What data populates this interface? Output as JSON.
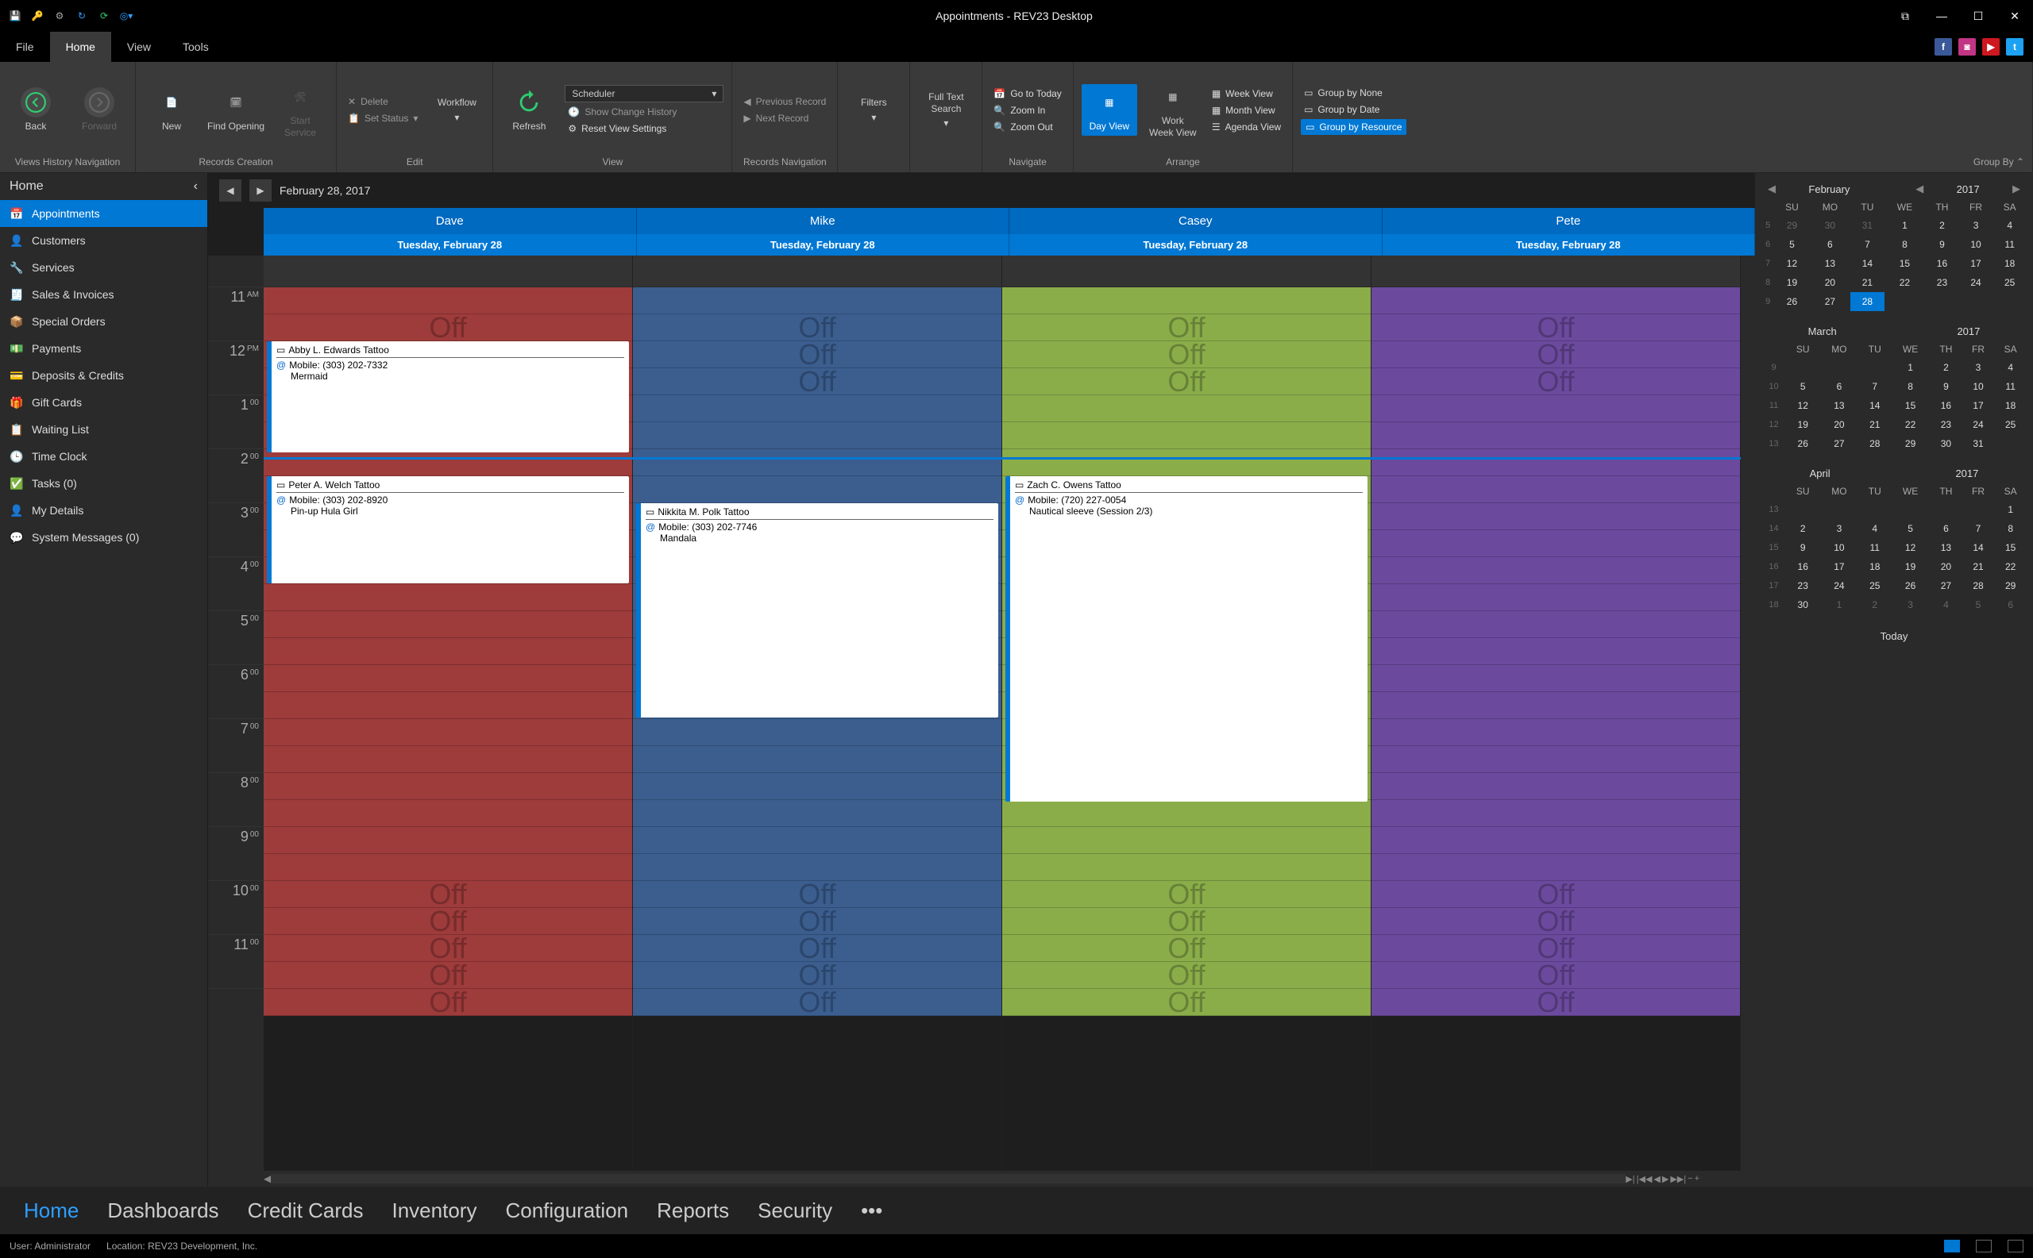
{
  "window": {
    "title": "Appointments - REV23 Desktop"
  },
  "menutabs": {
    "file": "File",
    "home": "Home",
    "view": "View",
    "tools": "Tools"
  },
  "ribbon": {
    "groups": {
      "nav": {
        "label": "Views History Navigation",
        "back": "Back",
        "forward": "Forward"
      },
      "records": {
        "label": "Records Creation",
        "new": "New",
        "find": "Find Opening",
        "start": "Start\nService"
      },
      "edit": {
        "label": "Edit",
        "delete": "Delete",
        "status": "Set Status",
        "workflow": "Workflow"
      },
      "view": {
        "label": "View",
        "refresh": "Refresh",
        "scheduler": "Scheduler",
        "history": "Show Change History",
        "reset": "Reset View Settings"
      },
      "recnav": {
        "label": "Records Navigation",
        "prev": "Previous Record",
        "next": "Next Record"
      },
      "filters": "Filters",
      "fulltext": "Full Text\nSearch",
      "navigate": {
        "label": "Navigate",
        "today": "Go to Today",
        "zoomin": "Zoom In",
        "zoomout": "Zoom Out"
      },
      "arrange": {
        "label": "Arrange",
        "dayview": "Day View",
        "workweek": "Work\nWeek View",
        "week": "Week View",
        "month": "Month View",
        "agenda": "Agenda View"
      },
      "groupby": {
        "label": "Group By",
        "none": "Group by None",
        "date": "Group by Date",
        "resource": "Group by Resource"
      }
    }
  },
  "leftnav": {
    "header": "Home",
    "items": [
      "Appointments",
      "Customers",
      "Services",
      "Sales & Invoices",
      "Special Orders",
      "Payments",
      "Deposits & Credits",
      "Gift Cards",
      "Waiting List",
      "Time Clock",
      "Tasks (0)",
      "My Details",
      "System Messages (0)"
    ]
  },
  "datebar": {
    "date": "February 28, 2017"
  },
  "resources": [
    "Dave",
    "Mike",
    "Casey",
    "Pete"
  ],
  "dayheader": "Tuesday, February 28",
  "times": [
    "11 AM",
    "12 PM",
    "1 00",
    "2 00",
    "3 00",
    "4 00",
    "5 00",
    "6 00",
    "7 00",
    "8 00",
    "9 00",
    "10 00",
    "11 00"
  ],
  "off": "Off",
  "appointments": {
    "dave1": {
      "title": "Abby L. Edwards Tattoo",
      "phone": "Mobile: (303) 202-7332",
      "desc": "Mermaid"
    },
    "dave2": {
      "title": "Peter A. Welch Tattoo",
      "phone": "Mobile: (303) 202-8920",
      "desc": "Pin-up Hula Girl"
    },
    "mike1": {
      "title": "Nikkita M. Polk Tattoo",
      "phone": "Mobile: (303) 202-7746",
      "desc": "Mandala"
    },
    "casey1": {
      "title": "Zach C. Owens Tattoo",
      "phone": "Mobile: (720) 227-0054",
      "desc": "Nautical sleeve (Session 2/3)"
    }
  },
  "minicalendars": {
    "dow": [
      "SU",
      "MO",
      "TU",
      "WE",
      "TH",
      "FR",
      "SA"
    ],
    "feb": {
      "month": "February",
      "year": "2017",
      "weeks": [
        {
          "wk": "5",
          "days": [
            {
              "d": "29",
              "dim": true
            },
            {
              "d": "30",
              "dim": true
            },
            {
              "d": "31",
              "dim": true
            },
            {
              "d": "1"
            },
            {
              "d": "2"
            },
            {
              "d": "3"
            },
            {
              "d": "4"
            }
          ]
        },
        {
          "wk": "6",
          "days": [
            {
              "d": "5"
            },
            {
              "d": "6"
            },
            {
              "d": "7"
            },
            {
              "d": "8"
            },
            {
              "d": "9"
            },
            {
              "d": "10"
            },
            {
              "d": "11"
            }
          ]
        },
        {
          "wk": "7",
          "days": [
            {
              "d": "12"
            },
            {
              "d": "13"
            },
            {
              "d": "14"
            },
            {
              "d": "15"
            },
            {
              "d": "16"
            },
            {
              "d": "17"
            },
            {
              "d": "18"
            }
          ]
        },
        {
          "wk": "8",
          "days": [
            {
              "d": "19"
            },
            {
              "d": "20"
            },
            {
              "d": "21"
            },
            {
              "d": "22"
            },
            {
              "d": "23"
            },
            {
              "d": "24"
            },
            {
              "d": "25"
            }
          ]
        },
        {
          "wk": "9",
          "days": [
            {
              "d": "26"
            },
            {
              "d": "27"
            },
            {
              "d": "28",
              "sel": true
            },
            {
              "d": ""
            },
            {
              "d": ""
            },
            {
              "d": ""
            },
            {
              "d": ""
            }
          ]
        }
      ]
    },
    "mar": {
      "month": "March",
      "year": "2017",
      "weeks": [
        {
          "wk": "9",
          "days": [
            {
              "d": ""
            },
            {
              "d": ""
            },
            {
              "d": ""
            },
            {
              "d": "1"
            },
            {
              "d": "2"
            },
            {
              "d": "3"
            },
            {
              "d": "4"
            }
          ]
        },
        {
          "wk": "10",
          "days": [
            {
              "d": "5"
            },
            {
              "d": "6"
            },
            {
              "d": "7"
            },
            {
              "d": "8"
            },
            {
              "d": "9"
            },
            {
              "d": "10"
            },
            {
              "d": "11"
            }
          ]
        },
        {
          "wk": "11",
          "days": [
            {
              "d": "12"
            },
            {
              "d": "13"
            },
            {
              "d": "14"
            },
            {
              "d": "15"
            },
            {
              "d": "16"
            },
            {
              "d": "17"
            },
            {
              "d": "18"
            }
          ]
        },
        {
          "wk": "12",
          "days": [
            {
              "d": "19"
            },
            {
              "d": "20"
            },
            {
              "d": "21"
            },
            {
              "d": "22"
            },
            {
              "d": "23"
            },
            {
              "d": "24"
            },
            {
              "d": "25"
            }
          ]
        },
        {
          "wk": "13",
          "days": [
            {
              "d": "26"
            },
            {
              "d": "27"
            },
            {
              "d": "28"
            },
            {
              "d": "29"
            },
            {
              "d": "30"
            },
            {
              "d": "31"
            },
            {
              "d": ""
            }
          ]
        }
      ]
    },
    "apr": {
      "month": "April",
      "year": "2017",
      "weeks": [
        {
          "wk": "13",
          "days": [
            {
              "d": ""
            },
            {
              "d": ""
            },
            {
              "d": ""
            },
            {
              "d": ""
            },
            {
              "d": ""
            },
            {
              "d": ""
            },
            {
              "d": "1"
            }
          ]
        },
        {
          "wk": "14",
          "days": [
            {
              "d": "2"
            },
            {
              "d": "3"
            },
            {
              "d": "4"
            },
            {
              "d": "5"
            },
            {
              "d": "6"
            },
            {
              "d": "7"
            },
            {
              "d": "8"
            }
          ]
        },
        {
          "wk": "15",
          "days": [
            {
              "d": "9"
            },
            {
              "d": "10"
            },
            {
              "d": "11"
            },
            {
              "d": "12"
            },
            {
              "d": "13"
            },
            {
              "d": "14"
            },
            {
              "d": "15"
            }
          ]
        },
        {
          "wk": "16",
          "days": [
            {
              "d": "16"
            },
            {
              "d": "17"
            },
            {
              "d": "18"
            },
            {
              "d": "19"
            },
            {
              "d": "20"
            },
            {
              "d": "21"
            },
            {
              "d": "22"
            }
          ]
        },
        {
          "wk": "17",
          "days": [
            {
              "d": "23"
            },
            {
              "d": "24"
            },
            {
              "d": "25"
            },
            {
              "d": "26"
            },
            {
              "d": "27"
            },
            {
              "d": "28"
            },
            {
              "d": "29"
            }
          ]
        },
        {
          "wk": "18",
          "days": [
            {
              "d": "30"
            },
            {
              "d": "1",
              "dim": true
            },
            {
              "d": "2",
              "dim": true
            },
            {
              "d": "3",
              "dim": true
            },
            {
              "d": "4",
              "dim": true
            },
            {
              "d": "5",
              "dim": true
            },
            {
              "d": "6",
              "dim": true
            }
          ]
        }
      ]
    },
    "today": "Today"
  },
  "bottomnav": [
    "Home",
    "Dashboards",
    "Credit Cards",
    "Inventory",
    "Configuration",
    "Reports",
    "Security"
  ],
  "statusbar": {
    "user": "User: Administrator",
    "location": "Location: REV23 Development, Inc."
  }
}
